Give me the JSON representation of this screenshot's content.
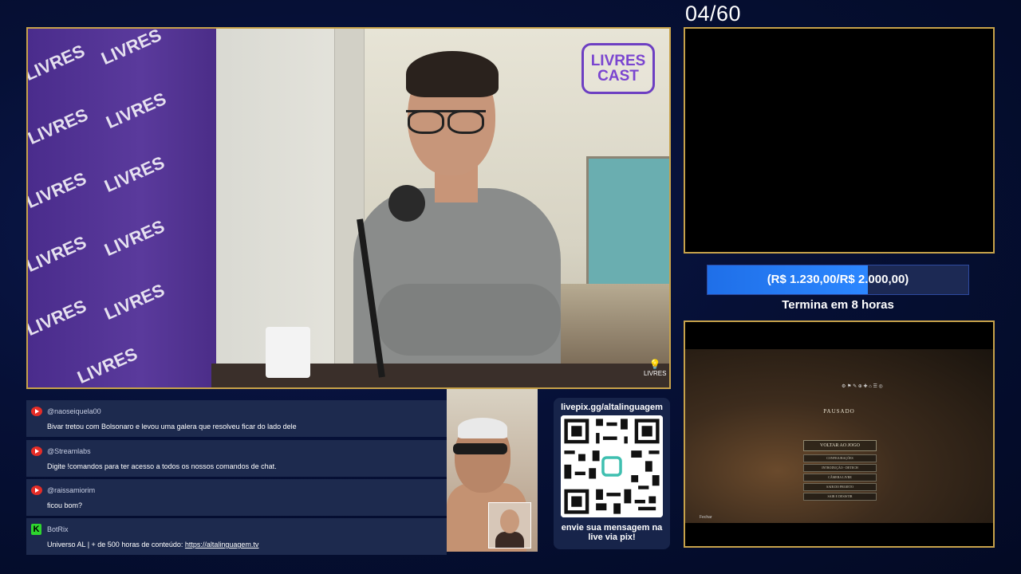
{
  "counter": "04/60",
  "main_video": {
    "banner_word": "LIVRES",
    "brand_logo": [
      "LIVRES",
      "CAST"
    ],
    "corner_logo": "LIVRES"
  },
  "chat": [
    {
      "platform": "youtube",
      "user": "@naoseiquela00",
      "text": "Bivar tretou com Bolsonaro e levou uma galera que resolveu ficar do lado dele"
    },
    {
      "platform": "youtube",
      "user": "@Streamlabs",
      "text": "Digite !comandos para ter acesso a todos os nossos comandos de chat."
    },
    {
      "platform": "youtube",
      "user": "@raissamiorim",
      "text": "ficou bom?"
    },
    {
      "platform": "kick",
      "user": "BotRix",
      "text_prefix": "Universo AL | + de 500 horas de conteúdo: ",
      "link": "https://altalinguagem.tv"
    }
  ],
  "pix": {
    "url": "livepix.gg/altalinguagem",
    "message": "envie sua mensagem na live via pix!"
  },
  "goal": {
    "label": "(R$ 1.230,00/R$ 2.000,00)",
    "current": 1230,
    "target": 2000,
    "subtitle": "Termina em 8 horas"
  },
  "game": {
    "paused_title": "PAUSADO",
    "resume_label": "VOLTAR AO JOGO",
    "menu_items": [
      "CONFIGURAÇÕES",
      "INTRODUÇÃO - DETECH",
      "CÂMERA LIVRE",
      "SAIR DO PROJETO",
      "SAIR E DESISTIR"
    ],
    "close_hint": "Fechar"
  },
  "colors": {
    "panel_border": "#c7a24a",
    "goal_fill": "#2c87ff",
    "chat_bg": "#1d2a4e",
    "youtube": "#e52d27",
    "kick": "#2ed62e"
  }
}
